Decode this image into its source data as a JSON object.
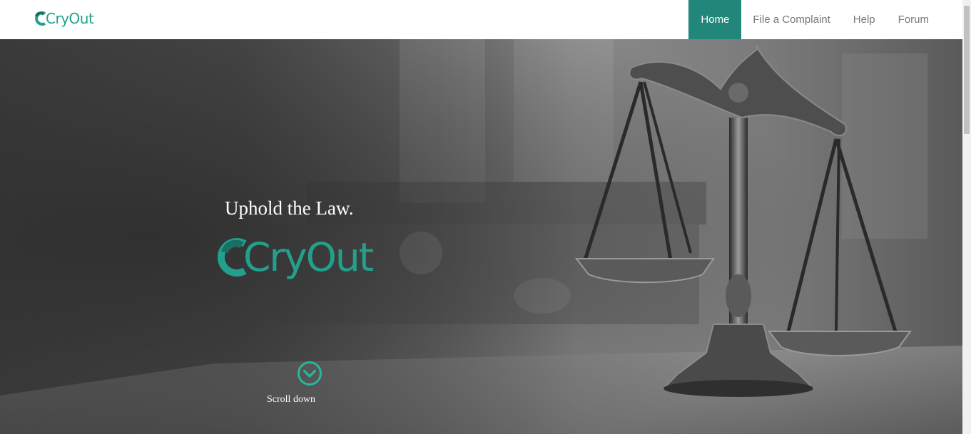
{
  "brand": {
    "name": "CryOut",
    "color": "#23a08c"
  },
  "nav": {
    "items": [
      {
        "label": "Home",
        "active": true
      },
      {
        "label": "File a Complaint",
        "active": false
      },
      {
        "label": "Help",
        "active": false
      },
      {
        "label": "Forum",
        "active": false
      }
    ],
    "active_color": "#22867b"
  },
  "hero": {
    "tagline": "Uphold the Law.",
    "logo_text": "CryOut",
    "scroll_label": "Scroll down",
    "scroll_icon": "chevron-down-circle-icon",
    "background": "scales-of-justice-photo"
  }
}
